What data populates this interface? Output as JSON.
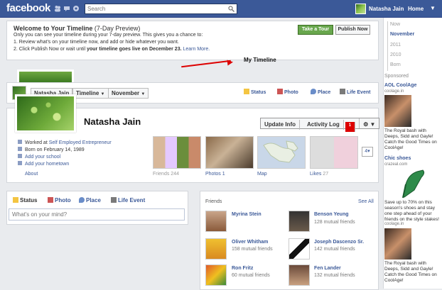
{
  "topbar": {
    "logo": "facebook",
    "search_placeholder": "Search",
    "profile_name": "Natasha Jain",
    "home": "Home",
    "caret": "▼"
  },
  "welcome": {
    "title": "Welcome to Your Timeline",
    "title_suffix": " (7-Day Preview)",
    "line1": "Only you can see your timeline during your 7-day preview. This gives you a chance to:",
    "line2": "1. Review what's on your timeline now, and add or hide whatever you want.",
    "line3_a": "2. Click Publish Now or wait until ",
    "line3_b": "your timeline goes live on December 23.",
    "line3_link": " Learn More.",
    "tour_button": "Take a Tour",
    "publish_button": "Publish Now"
  },
  "annotation": "My Timeline",
  "timeline_nav": {
    "name": "Natasha Jain",
    "timeline": "Timeline",
    "month": "November",
    "caret": "▼",
    "actions": [
      "Status",
      "Photo",
      "Place",
      "Life Event"
    ]
  },
  "profile": {
    "name": "Natasha Jain",
    "update_info": "Update Info",
    "activity_log": "Activity Log",
    "activity_count": "1",
    "settings_caret": "⚙ ▼",
    "info": [
      {
        "prefix": "Worked at ",
        "link": "Self Employed Entrepreneur"
      },
      {
        "prefix": "Born on February 14, 1989",
        "link": ""
      },
      {
        "prefix": "",
        "link": "Add your school"
      },
      {
        "prefix": "",
        "link": "Add your hometown"
      }
    ],
    "about": "About",
    "sections": [
      {
        "label": "Friends",
        "count": "244"
      },
      {
        "label": "Photos",
        "count": "1"
      },
      {
        "label": "Map",
        "count": ""
      },
      {
        "label": "Likes",
        "count": "27"
      }
    ],
    "pager": "4▾"
  },
  "composer": {
    "tabs": [
      "Status",
      "Photo",
      "Place",
      "Life Event"
    ],
    "placeholder": "What's on your mind?"
  },
  "friends": {
    "title": "Friends",
    "see_all": "See All",
    "list": [
      {
        "name": "Myrina Stein",
        "mutual": ""
      },
      {
        "name": "Benson Yeung",
        "mutual": "128 mutual friends"
      },
      {
        "name": "Oliver Whitham",
        "mutual": "158 mutual friends"
      },
      {
        "name": "Joseph Dascenzo Sr.",
        "mutual": "142 mutual friends"
      },
      {
        "name": "Ron Fritz",
        "mutual": "60 mutual friends"
      },
      {
        "name": "Fen Lander",
        "mutual": "132 mutual friends"
      }
    ]
  },
  "rail": {
    "years": [
      "Now",
      "November",
      "2011",
      "2010",
      "Born"
    ],
    "sponsored": "Sponsored",
    "ads": [
      {
        "title": "AOL CoolAge",
        "host": "coolage.in",
        "text": "The Royal bash with Deeps, Sidd and Gayle! Catch the Good Times on CoolAge!"
      },
      {
        "title": "Chic shoes",
        "host": "crazeal.com",
        "text": "Save up to 70% on this season's shoes and stay one step ahead of your friends on the style stakes!"
      },
      {
        "title": "",
        "host": "coolage.in",
        "text": "The Royal bash with Deeps, Sidd and Gayle! Catch the Good Times on CoolAge!"
      }
    ]
  }
}
